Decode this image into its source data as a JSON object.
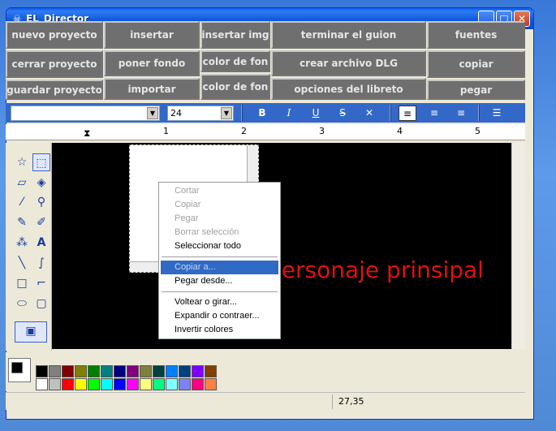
{
  "window": {
    "title": "EL_Director"
  },
  "buttons": {
    "nuevo_proyecto": "nuevo proyecto",
    "insertar": "insertar",
    "insertar_img": "insertar img",
    "terminar_guion": "terminar el guion",
    "fuentes": "fuentes",
    "cerrar_proyecto": "cerrar proyecto",
    "poner_fondo": "poner fondo",
    "color_fon_1": "color de fon",
    "crear_dlg": "crear archivo DLG",
    "copiar": "copiar",
    "guardar_proyecto": "guardar proyecto",
    "importar": "importar",
    "color_fon_2": "color de fon",
    "opciones_libreto": "opciones del libreto",
    "pegar": "pegar"
  },
  "format": {
    "font_name": "",
    "font_size": "24"
  },
  "ruler": {
    "marks": [
      "1",
      "2",
      "3",
      "4",
      "5"
    ]
  },
  "canvas": {
    "text": "personaje prinsipal"
  },
  "context_menu": {
    "items": [
      "Cortar",
      "Copiar",
      "Pegar",
      "Borrar selección",
      "Seleccionar todo",
      "Copiar a...",
      "Pegar desde...",
      "Voltear o girar...",
      "Expandir o contraer...",
      "Invertir colores"
    ]
  },
  "palette": {
    "colors": [
      "#000000",
      "#808080",
      "#800000",
      "#808000",
      "#008000",
      "#008080",
      "#000080",
      "#800080",
      "#808040",
      "#004040",
      "#0080ff",
      "#004080",
      "#8000ff",
      "#804000",
      "#ffffff",
      "#c0c0c0",
      "#ff0000",
      "#ffff00",
      "#00ff00",
      "#00ffff",
      "#0000ff",
      "#ff00ff",
      "#ffff80",
      "#00ff80",
      "#80ffff",
      "#8080ff",
      "#ff0080",
      "#ff8040"
    ]
  },
  "status": {
    "coords": "27,35"
  }
}
